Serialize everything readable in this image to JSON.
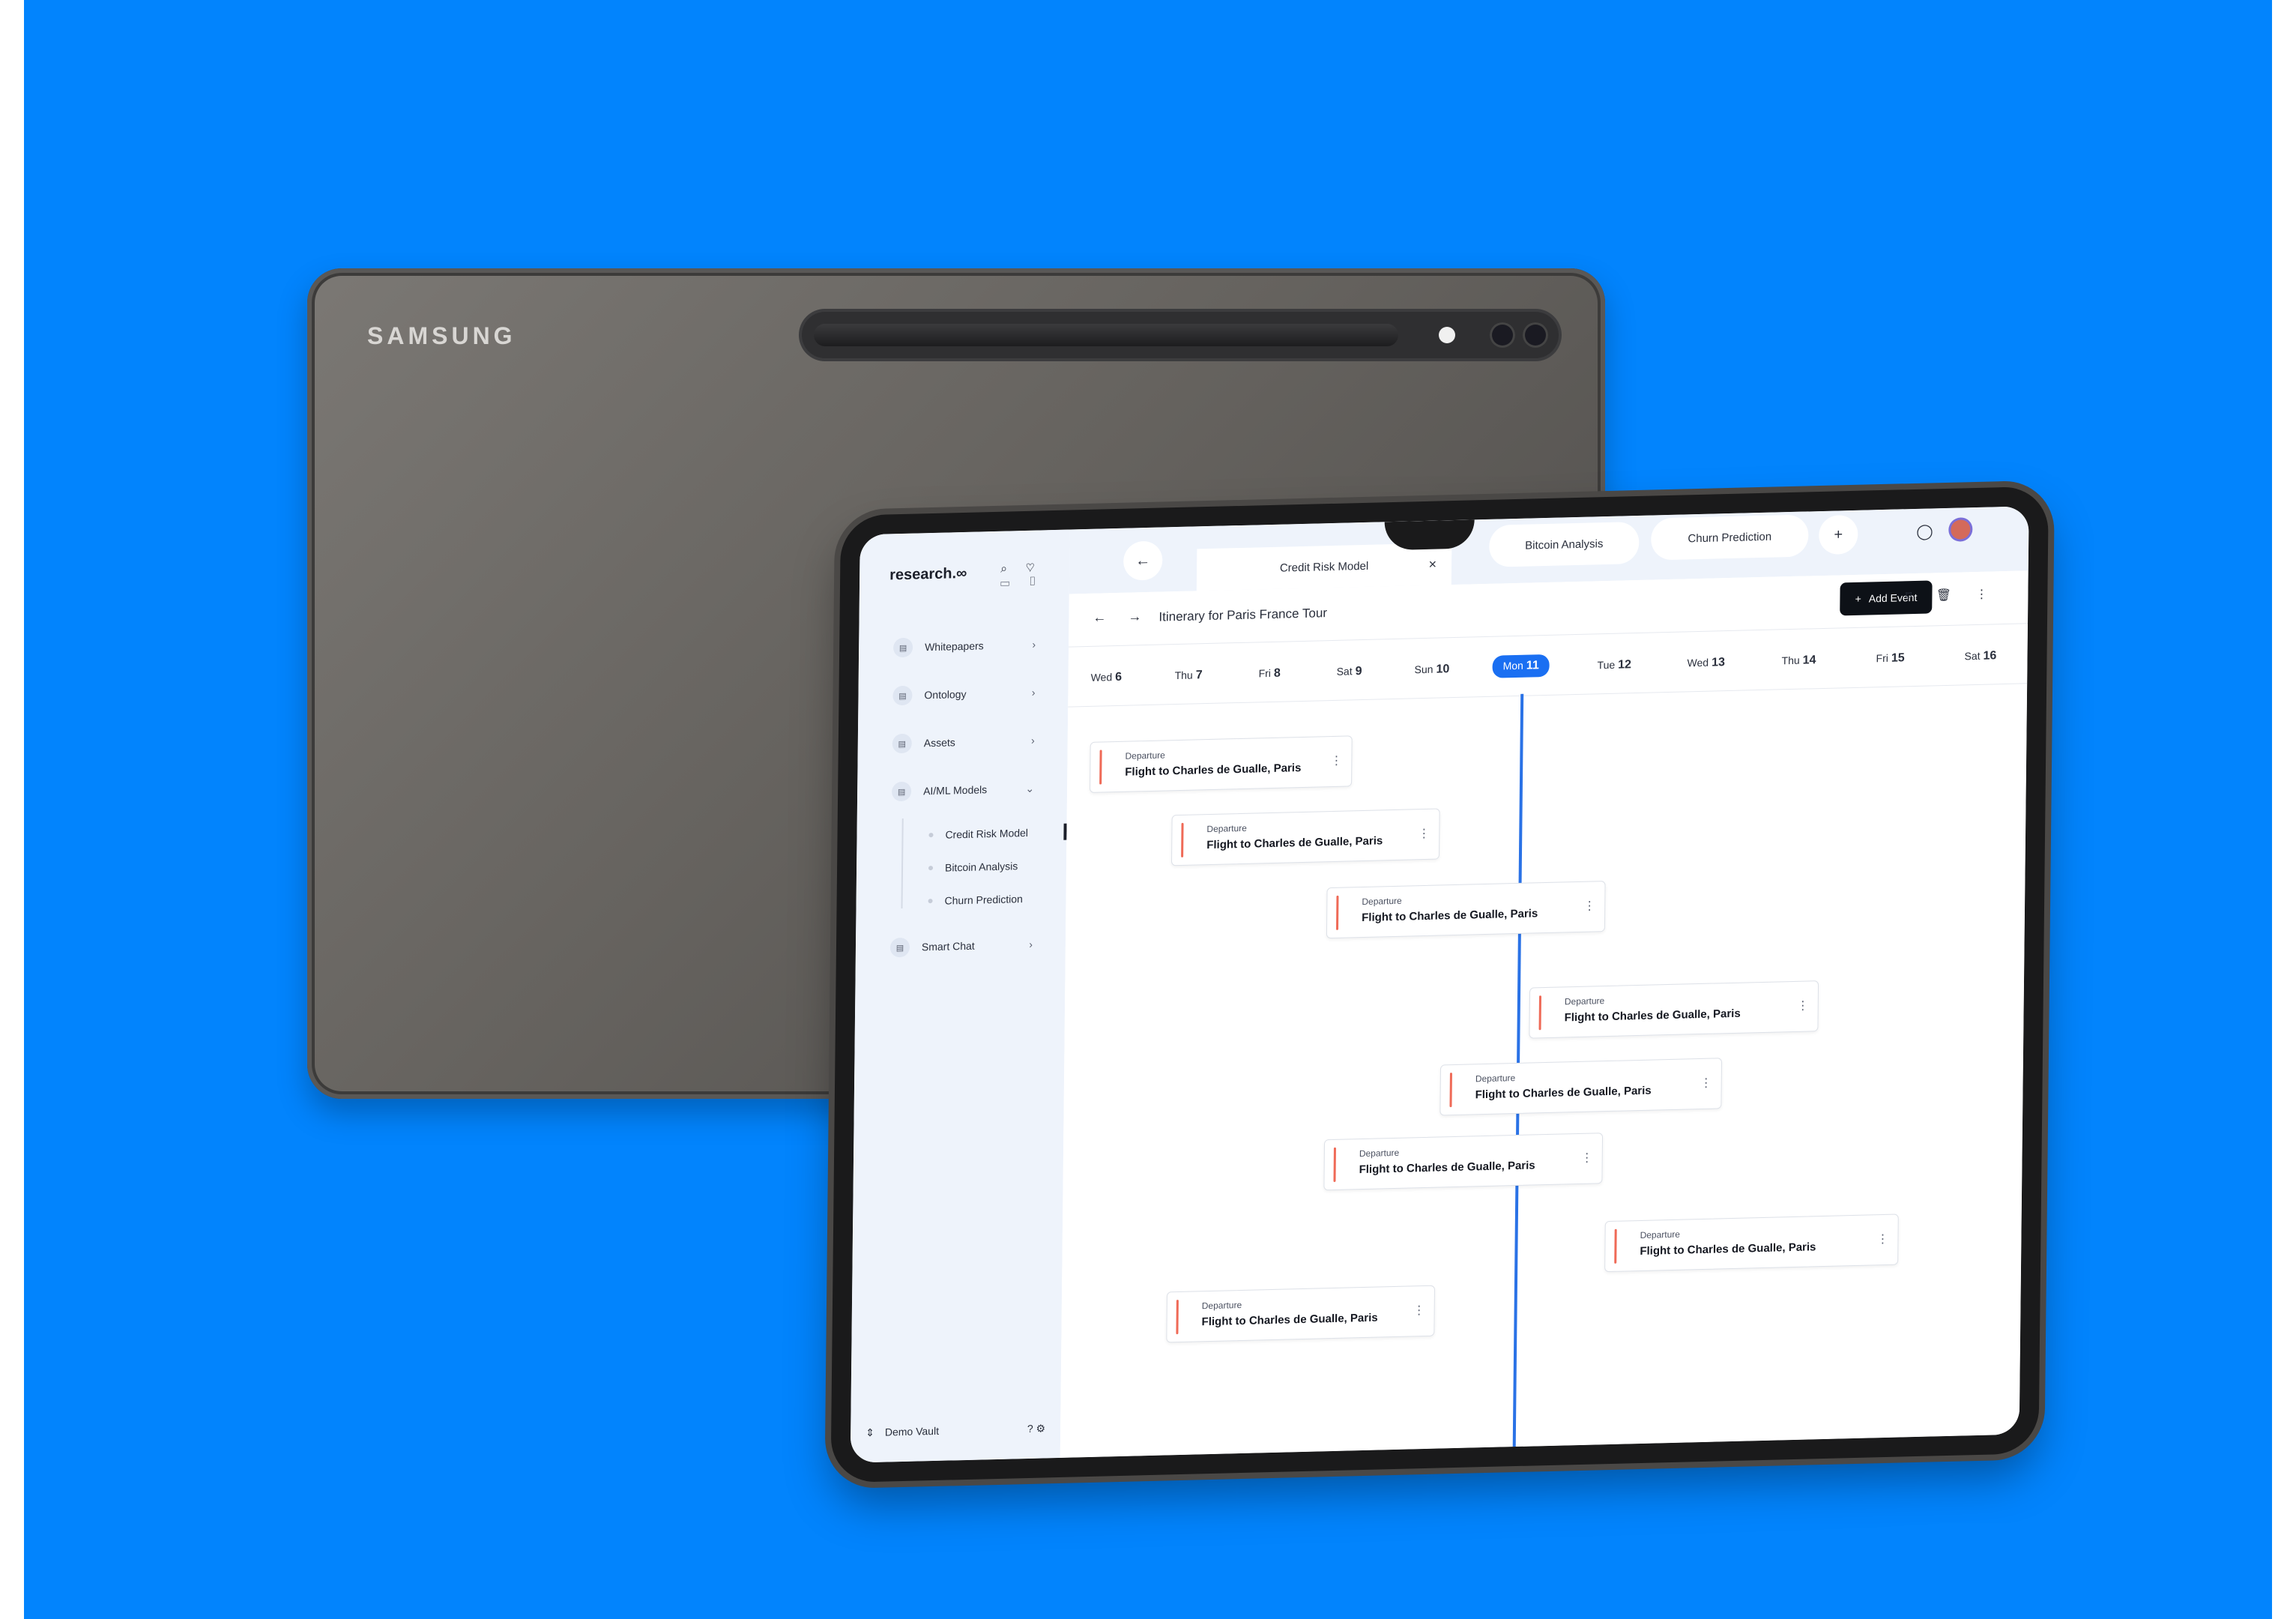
{
  "back_device": {
    "brand": "SAMSUNG"
  },
  "app": {
    "brand": "research.∞",
    "tool_icons": "⌕ ♡ ▭ ▯",
    "sidebar": {
      "items": [
        {
          "label": "Whitepapers",
          "chevron": "›"
        },
        {
          "label": "Ontology",
          "chevron": "›"
        },
        {
          "label": "Assets",
          "chevron": "›"
        },
        {
          "label": "AI/ML Models",
          "chevron": "⌄"
        },
        {
          "label": "Smart Chat",
          "chevron": "›"
        }
      ],
      "sub_items": [
        "Credit Risk Model",
        "Bitcoin Analysis",
        "Churn Prediction"
      ],
      "footer": {
        "vault": "Demo Vault",
        "toggle": "⇕",
        "icons": "? ⚙"
      }
    },
    "tabs": {
      "back": "←",
      "active": "Credit Risk Model",
      "close": "×",
      "others": [
        "Bitcoin Analysis",
        "Churn Prediction"
      ],
      "add": "+",
      "chat_icon": "◯",
      "avatar": "●"
    },
    "toolbar": {
      "arrows": "← →",
      "title": "Itinerary for Paris France Tour",
      "add_event": "Add Event",
      "add_plus": "+",
      "icons": "⌑ 🗑 ⋮"
    },
    "days": [
      {
        "dow": "Wed",
        "num": "6"
      },
      {
        "dow": "Thu",
        "num": "7"
      },
      {
        "dow": "Fri",
        "num": "8"
      },
      {
        "dow": "Sat",
        "num": "9"
      },
      {
        "dow": "Sun",
        "num": "10"
      },
      {
        "dow": "Mon",
        "num": "11",
        "active": true
      },
      {
        "dow": "Tue",
        "num": "12"
      },
      {
        "dow": "Wed",
        "num": "13"
      },
      {
        "dow": "Thu",
        "num": "14"
      },
      {
        "dow": "Fri",
        "num": "15"
      },
      {
        "dow": "Sat",
        "num": "16"
      }
    ],
    "events": [
      {
        "label": "Departure",
        "title": "Flight to Charles de Gualle, Paris"
      },
      {
        "label": "Departure",
        "title": "Flight to Charles de Gualle, Paris"
      },
      {
        "label": "Departure",
        "title": "Flight to Charles de Gualle, Paris"
      },
      {
        "label": "Departure",
        "title": "Flight to Charles de Gualle, Paris"
      },
      {
        "label": "Departure",
        "title": "Flight to Charles de Gualle, Paris"
      },
      {
        "label": "Departure",
        "title": "Flight to Charles de Gualle, Paris"
      },
      {
        "label": "Departure",
        "title": "Flight to Charles de Gualle, Paris"
      },
      {
        "label": "Departure",
        "title": "Flight to Charles de Gualle, Paris"
      }
    ],
    "colors": {
      "accent": "#1a6ff2",
      "event_bar": "#ef6a57",
      "background": "#0284fd"
    }
  }
}
